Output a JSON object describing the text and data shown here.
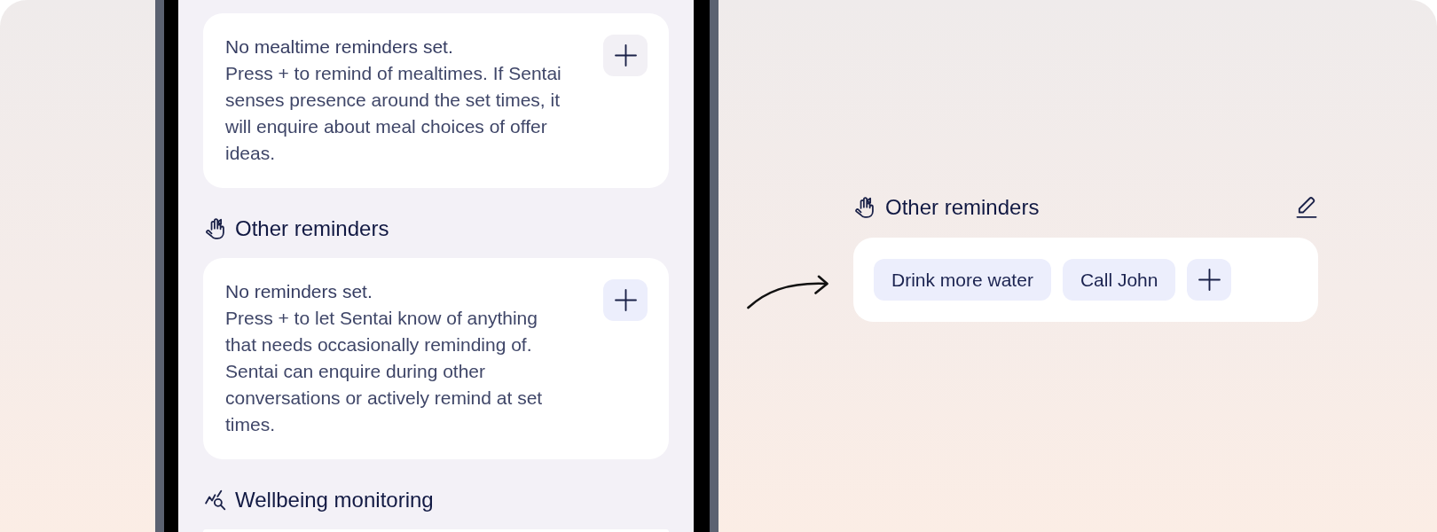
{
  "phone": {
    "mealtime_card": {
      "title": "No mealtime reminders set.",
      "description": "Press + to remind of mealtimes. If Sentai senses presence around the set times, it will enquire about meal choices of offer ideas."
    },
    "other_reminders": {
      "heading": "Other reminders",
      "card": {
        "title": "No reminders set.",
        "description": "Press + to let Sentai know of anything that needs occasionally reminding of. Sentai can enquire during other conversations or actively remind at set times."
      }
    },
    "wellbeing_monitoring": {
      "heading": "Wellbeing monitoring"
    }
  },
  "other_reminders_detail": {
    "heading": "Other reminders",
    "reminders": [
      "Drink more water",
      "Call John"
    ]
  }
}
